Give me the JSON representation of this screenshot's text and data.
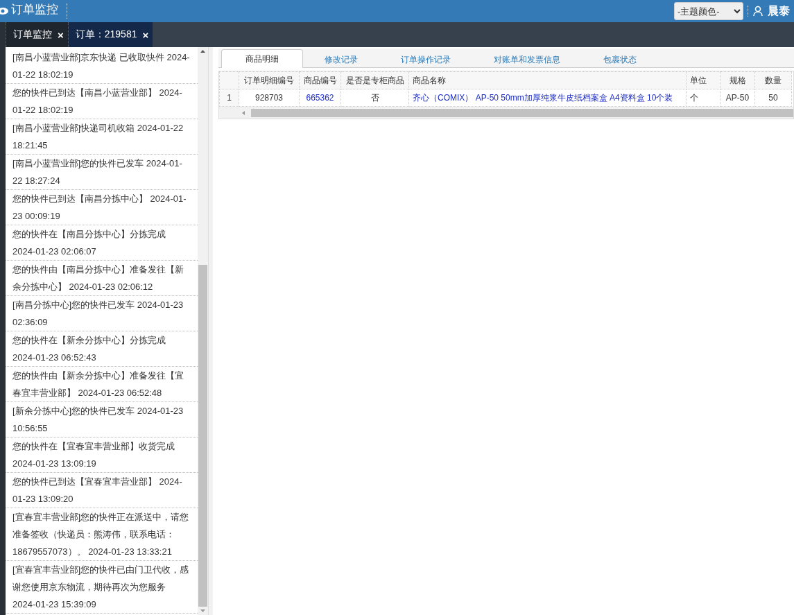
{
  "header": {
    "title": "订单监控",
    "theme_select": {
      "value": "-主题颜色-"
    },
    "user": "晨泰"
  },
  "page_tabs": [
    {
      "label": "订单监控",
      "selected": false,
      "close": "×"
    },
    {
      "label": "订单：219581",
      "selected": true,
      "close": "×"
    }
  ],
  "tracking_log": [
    "[南昌小蓝营业部]京东快递 已收取快件 2024-01-22 18:02:19",
    "您的快件已到达【南昌小蓝营业部】 2024-01-22 18:02:19",
    "[南昌小蓝营业部]快递司机收箱 2024-01-22 18:21:45",
    "[南昌小蓝营业部]您的快件已发车 2024-01-22 18:27:24",
    "您的快件已到达【南昌分拣中心】 2024-01-23 00:09:19",
    "您的快件在【南昌分拣中心】分拣完成 2024-01-23 02:06:07",
    "您的快件由【南昌分拣中心】准备发往【新余分拣中心】 2024-01-23 02:06:12",
    "[南昌分拣中心]您的快件已发车 2024-01-23 02:36:09",
    "您的快件在【新余分拣中心】分拣完成 2024-01-23 06:52:43",
    "您的快件由【新余分拣中心】准备发往【宜春宜丰营业部】 2024-01-23 06:52:48",
    "[新余分拣中心]您的快件已发车 2024-01-23 10:56:55",
    "您的快件在【宜春宜丰营业部】收货完成 2024-01-23 13:09:19",
    "您的快件已到达【宜春宜丰营业部】 2024-01-23 13:09:20",
    "[宜春宜丰营业部]您的快件正在派送中，请您准备签收（快递员：熊涛伟，联系电话：18679557073）。 2024-01-23 13:33:21",
    "[宜春宜丰营业部]您的快件已由门卫代收，感谢您使用京东物流，期待再次为您服务 2024-01-23 15:39:09"
  ],
  "detail_tabs": [
    {
      "label": "商品明细",
      "selected": true
    },
    {
      "label": "修改记录",
      "selected": false
    },
    {
      "label": "订单操作记录",
      "selected": false
    },
    {
      "label": "对账单和发票信息",
      "selected": false
    },
    {
      "label": "包裹状态",
      "selected": false
    }
  ],
  "table": {
    "columns": [
      "订单明细编号",
      "商品编号",
      "是否是专柜商品",
      "商品名称",
      "单位",
      "规格",
      "数量"
    ],
    "rows": [
      {
        "number": "1",
        "cells": [
          {
            "text": "928703",
            "kind": "plain"
          },
          {
            "text": "665362",
            "kind": "link"
          },
          {
            "text": "否",
            "kind": "plain"
          },
          {
            "text": "齐心（COMIX） AP-50 50mm加厚纯浆牛皮纸档案盒 A4资料盒 10个装",
            "kind": "link"
          },
          {
            "text": "个",
            "kind": "plain"
          },
          {
            "text": "AP-50",
            "kind": "plain"
          },
          {
            "text": "50",
            "kind": "plain"
          }
        ]
      }
    ]
  }
}
